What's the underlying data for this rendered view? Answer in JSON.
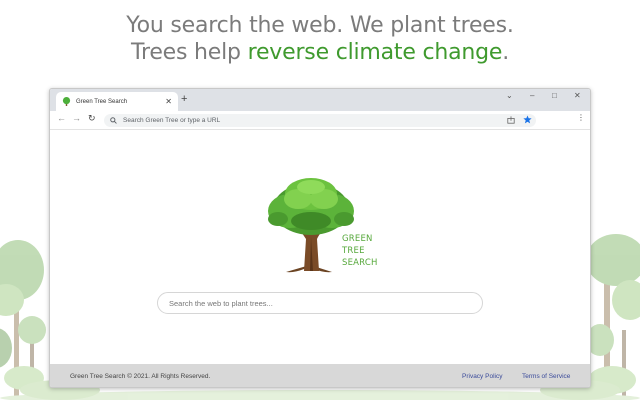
{
  "headline": {
    "line1": "You search the web. We plant trees.",
    "line2_prefix": "Trees help ",
    "line2_accent": "reverse climate change",
    "line2_suffix": "."
  },
  "colors": {
    "accent": "#3f9a2e",
    "footer_bg": "#d8d8d8",
    "link": "#3a4a9a"
  },
  "browser": {
    "tab": {
      "title": "Green Tree Search",
      "favicon": "tree-icon"
    },
    "new_tab": "+",
    "window_controls": {
      "collapse": "⌄",
      "minimize": "–",
      "maximize": "□",
      "close": "✕"
    },
    "toolbar": {
      "back": "←",
      "forward": "→",
      "reload": "↻",
      "menu": "⋮"
    },
    "omnibox": {
      "placeholder": "Search Green Tree or type a URL"
    }
  },
  "page": {
    "brand": {
      "line1": "GREEN",
      "line2": "TREE",
      "line3": "SEARCH"
    },
    "search": {
      "placeholder": "Search the web to plant trees..."
    },
    "footer": {
      "copyright": "Green Tree Search © 2021. All Rights Reserved.",
      "privacy": "Privacy Policy",
      "terms": "Terms of Service"
    }
  }
}
